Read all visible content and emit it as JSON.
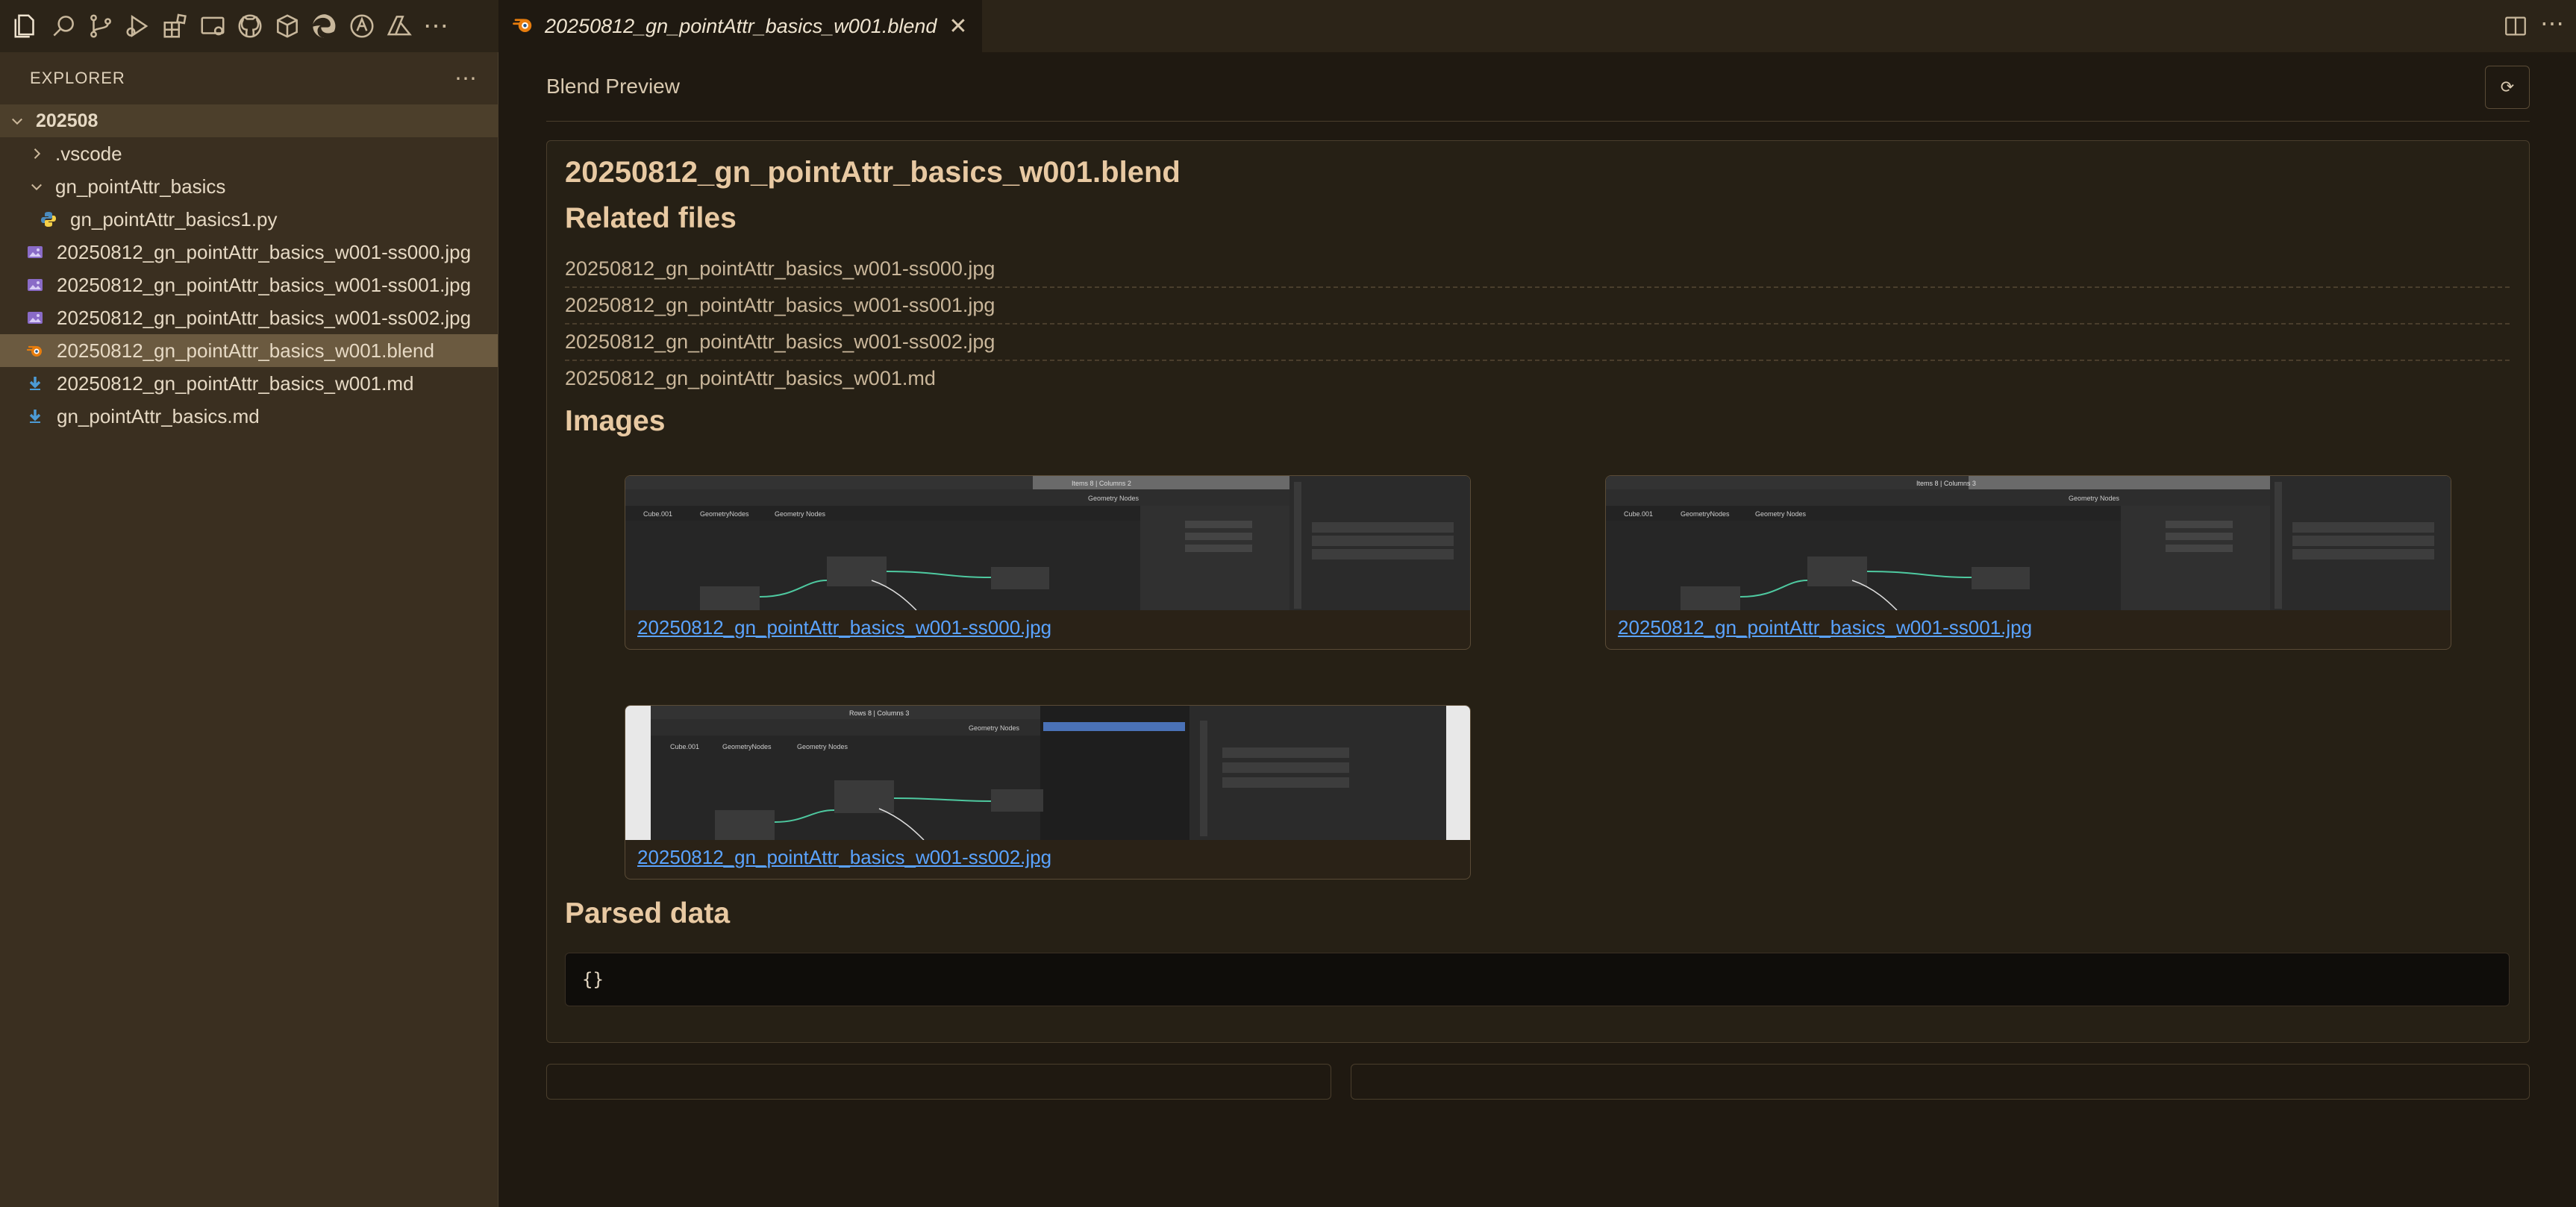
{
  "activity_bar": {
    "icons": [
      "explorer-icon",
      "search-icon",
      "source-control-icon",
      "run-debug-icon",
      "extensions-icon",
      "remote-explorer-icon",
      "github-icon",
      "packages-icon",
      "edge-icon",
      "blender-icon",
      "azure-icon",
      "more-icon"
    ]
  },
  "sidebar": {
    "title": "EXPLORER",
    "root": "202508",
    "items": [
      {
        "label": ".vscode",
        "type": "folder",
        "expanded": false,
        "indent": 1
      },
      {
        "label": "gn_pointAttr_basics",
        "type": "folder",
        "expanded": true,
        "indent": 1
      },
      {
        "label": "gn_pointAttr_basics1.py",
        "type": "python",
        "indent": 2
      },
      {
        "label": "20250812_gn_pointAttr_basics_w001-ss000.jpg",
        "type": "image",
        "indent": 1
      },
      {
        "label": "20250812_gn_pointAttr_basics_w001-ss001.jpg",
        "type": "image",
        "indent": 1
      },
      {
        "label": "20250812_gn_pointAttr_basics_w001-ss002.jpg",
        "type": "image",
        "indent": 1
      },
      {
        "label": "20250812_gn_pointAttr_basics_w001.blend",
        "type": "blend",
        "indent": 1,
        "selected": true
      },
      {
        "label": "20250812_gn_pointAttr_basics_w001.md",
        "type": "markdown",
        "indent": 1
      },
      {
        "label": "gn_pointAttr_basics.md",
        "type": "markdown",
        "indent": 1
      }
    ]
  },
  "tab": {
    "label": "20250812_gn_pointAttr_basics_w001.blend",
    "close": "✕"
  },
  "preview": {
    "header": "Blend Preview",
    "refresh_glyph": "⟳",
    "filename": "20250812_gn_pointAttr_basics_w001.blend",
    "related_heading": "Related files",
    "related": [
      "20250812_gn_pointAttr_basics_w001-ss000.jpg",
      "20250812_gn_pointAttr_basics_w001-ss001.jpg",
      "20250812_gn_pointAttr_basics_w001-ss002.jpg",
      "20250812_gn_pointAttr_basics_w001.md"
    ],
    "images_heading": "Images",
    "images": [
      {
        "caption": "20250812_gn_pointAttr_basics_w001-ss000.jpg",
        "shot": {
          "status": "Items 8 | Columns 2",
          "b": "Geometry Nodes",
          "c": "Cube.001",
          "d": "GeometryNodes",
          "e": "Geometry Nodes"
        }
      },
      {
        "caption": "20250812_gn_pointAttr_basics_w001-ss001.jpg",
        "shot": {
          "status": "Items 8 | Columns 3",
          "b": "Geometry Nodes",
          "c": "Cube.001",
          "d": "GeometryNodes",
          "e": "Geometry Nodes"
        }
      },
      {
        "caption": "20250812_gn_pointAttr_basics_w001-ss002.jpg",
        "shot": {
          "status": "Rows 8 | Columns 3",
          "b": "Geometry Nodes",
          "c": "Cube.001",
          "d": "GeometryNodes",
          "e": "Geometry Nodes"
        }
      }
    ],
    "parsed_heading": "Parsed data",
    "parsed_value": "{}"
  },
  "colors": {
    "accent_link": "#5aa3ff",
    "heading": "#e8c9a2",
    "blender_orange": "#e87d0d"
  }
}
